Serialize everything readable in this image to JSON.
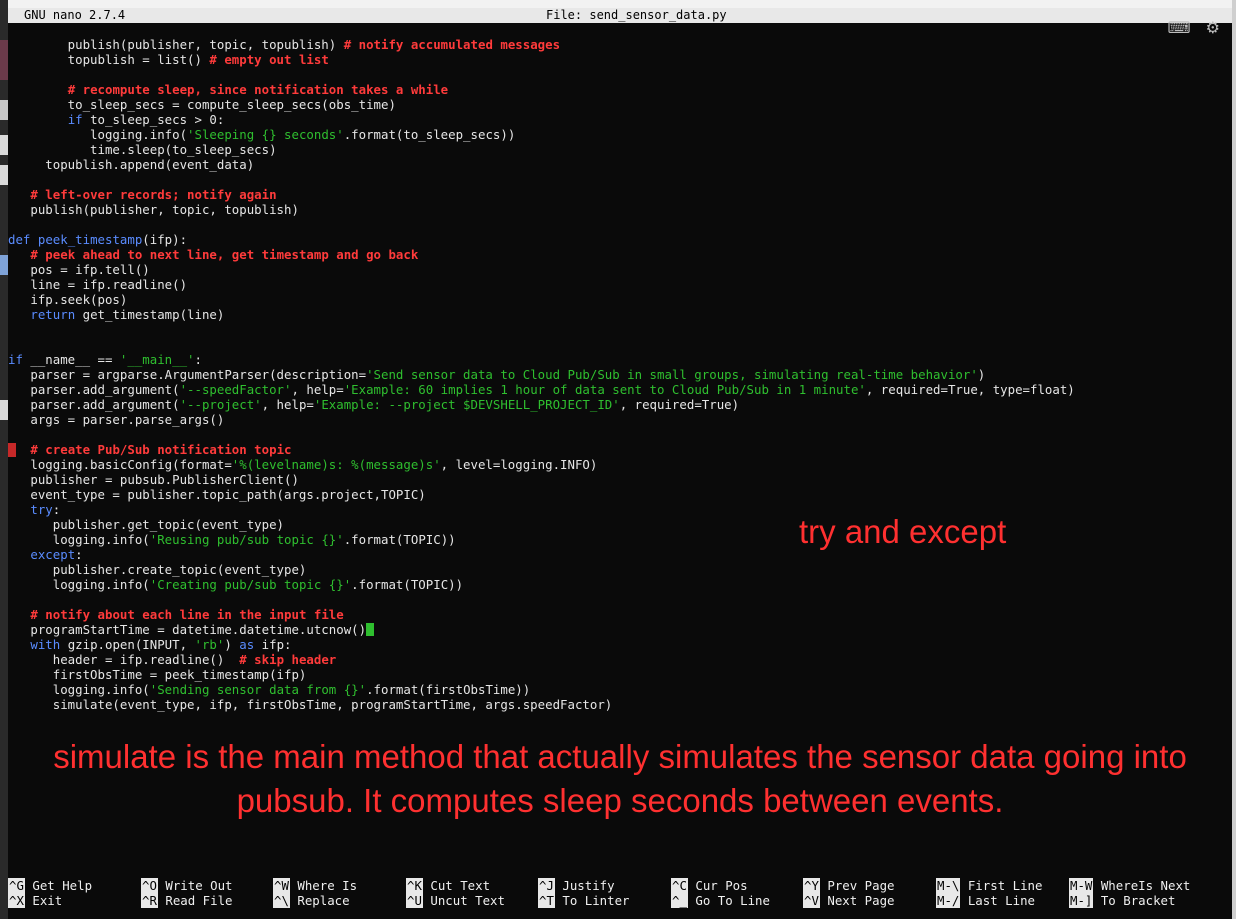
{
  "titlebar": {
    "version": "GNU nano 2.7.4",
    "file": "File: send_sensor_data.py"
  },
  "code_lines": [
    [
      [
        "p",
        "        publish(publisher, topic, topublish) "
      ],
      [
        "c",
        "# notify accumulated messages"
      ]
    ],
    [
      [
        "p",
        "        topublish = list() "
      ],
      [
        "c",
        "# empty out list"
      ]
    ],
    [
      [
        "p",
        ""
      ]
    ],
    [
      [
        "p",
        "        "
      ],
      [
        "c",
        "# recompute sleep, since notification takes a while"
      ]
    ],
    [
      [
        "p",
        "        to_sleep_secs = compute_sleep_secs(obs_time)"
      ]
    ],
    [
      [
        "p",
        "        "
      ],
      [
        "k",
        "if"
      ],
      [
        "p",
        " to_sleep_secs > 0:"
      ]
    ],
    [
      [
        "p",
        "           logging.info("
      ],
      [
        "s",
        "'Sleeping {} seconds'"
      ],
      [
        "p",
        ".format(to_sleep_secs))"
      ]
    ],
    [
      [
        "p",
        "           time.sleep(to_sleep_secs)"
      ]
    ],
    [
      [
        "p",
        "     topublish.append(event_data)"
      ]
    ],
    [
      [
        "p",
        ""
      ]
    ],
    [
      [
        "p",
        "   "
      ],
      [
        "c",
        "# left-over records; notify again"
      ]
    ],
    [
      [
        "p",
        "   publish(publisher, topic, topublish)"
      ]
    ],
    [
      [
        "p",
        ""
      ]
    ],
    [
      [
        "k",
        "def"
      ],
      [
        "p",
        " "
      ],
      [
        "k",
        "peek_timestamp"
      ],
      [
        "p",
        "(ifp):"
      ]
    ],
    [
      [
        "p",
        "   "
      ],
      [
        "c",
        "# peek ahead to next line, get timestamp and go back"
      ]
    ],
    [
      [
        "p",
        "   pos = ifp.tell()"
      ]
    ],
    [
      [
        "p",
        "   line = ifp.readline()"
      ]
    ],
    [
      [
        "p",
        "   ifp.seek(pos)"
      ]
    ],
    [
      [
        "p",
        "   "
      ],
      [
        "k",
        "return"
      ],
      [
        "p",
        " get_timestamp(line)"
      ]
    ],
    [
      [
        "p",
        ""
      ]
    ],
    [
      [
        "p",
        ""
      ]
    ],
    [
      [
        "k",
        "if"
      ],
      [
        "p",
        " __name__ == "
      ],
      [
        "s",
        "'__main__'"
      ],
      [
        "p",
        ":"
      ]
    ],
    [
      [
        "p",
        "   parser = argparse.ArgumentParser(description="
      ],
      [
        "s",
        "'Send sensor data to Cloud Pub/Sub in small groups, simulating real-time behavior'"
      ],
      [
        "p",
        ")"
      ]
    ],
    [
      [
        "p",
        "   parser.add_argument("
      ],
      [
        "s",
        "'--speedFactor'"
      ],
      [
        "p",
        ", help="
      ],
      [
        "s",
        "'Example: 60 implies 1 hour of data sent to Cloud Pub/Sub in 1 minute'"
      ],
      [
        "p",
        ", required=True, type=float)"
      ]
    ],
    [
      [
        "p",
        "   parser.add_argument("
      ],
      [
        "s",
        "'--project'"
      ],
      [
        "p",
        ", help="
      ],
      [
        "s",
        "'Example: --project $DEVSHELL_PROJECT_ID'"
      ],
      [
        "p",
        ", required=True)"
      ]
    ],
    [
      [
        "p",
        "   args = parser.parse_args()"
      ]
    ],
    [
      [
        "p",
        ""
      ]
    ],
    [
      [
        "p",
        "   "
      ],
      [
        "c",
        "# create Pub/Sub notification topic"
      ]
    ],
    [
      [
        "p",
        "   logging.basicConfig(format="
      ],
      [
        "s",
        "'%(levelname)s: %(message)s'"
      ],
      [
        "p",
        ", level=logging.INFO)"
      ]
    ],
    [
      [
        "p",
        "   publisher = pubsub.PublisherClient()"
      ]
    ],
    [
      [
        "p",
        "   event_type = publisher.topic_path(args.project,TOPIC)"
      ]
    ],
    [
      [
        "p",
        "   "
      ],
      [
        "k",
        "try"
      ],
      [
        "p",
        ":"
      ]
    ],
    [
      [
        "p",
        "      publisher.get_topic(event_type)"
      ]
    ],
    [
      [
        "p",
        "      logging.info("
      ],
      [
        "s",
        "'Reusing pub/sub topic {}'"
      ],
      [
        "p",
        ".format(TOPIC))"
      ]
    ],
    [
      [
        "p",
        "   "
      ],
      [
        "k",
        "except"
      ],
      [
        "p",
        ":"
      ]
    ],
    [
      [
        "p",
        "      publisher.create_topic(event_type)"
      ]
    ],
    [
      [
        "p",
        "      logging.info("
      ],
      [
        "s",
        "'Creating pub/sub topic {}'"
      ],
      [
        "p",
        ".format(TOPIC))"
      ]
    ],
    [
      [
        "p",
        ""
      ]
    ],
    [
      [
        "p",
        "   "
      ],
      [
        "c",
        "# notify about each line in the input file"
      ]
    ],
    [
      [
        "p",
        "   programStartTime = datetime.datetime.utcnow()"
      ],
      [
        "cursor",
        ""
      ]
    ],
    [
      [
        "p",
        "   "
      ],
      [
        "k",
        "with"
      ],
      [
        "p",
        " gzip.open(INPUT, "
      ],
      [
        "s",
        "'rb'"
      ],
      [
        "p",
        ") "
      ],
      [
        "k",
        "as"
      ],
      [
        "p",
        " ifp:"
      ]
    ],
    [
      [
        "p",
        "      header = ifp.readline()  "
      ],
      [
        "c",
        "# skip header"
      ]
    ],
    [
      [
        "p",
        "      firstObsTime = peek_timestamp(ifp)"
      ]
    ],
    [
      [
        "p",
        "      logging.info("
      ],
      [
        "s",
        "'Sending sensor data from {}'"
      ],
      [
        "p",
        ".format(firstObsTime))"
      ]
    ],
    [
      [
        "p",
        "      simulate(event_type, ifp, firstObsTime, programStartTime, args.speedFactor)"
      ]
    ]
  ],
  "annotations": {
    "try_note": "try and except",
    "simulate_note": "simulate is the main method that actually simulates the sensor data going into pubsub. It computes sleep seconds between events."
  },
  "shortcuts": [
    {
      "key": "^G",
      "label": "Get Help"
    },
    {
      "key": "^X",
      "label": "Exit"
    },
    {
      "key": "^O",
      "label": "Write Out"
    },
    {
      "key": "^R",
      "label": "Read File"
    },
    {
      "key": "^W",
      "label": "Where Is"
    },
    {
      "key": "^\\",
      "label": "Replace"
    },
    {
      "key": "^K",
      "label": "Cut Text"
    },
    {
      "key": "^U",
      "label": "Uncut Text"
    },
    {
      "key": "^J",
      "label": "Justify"
    },
    {
      "key": "^T",
      "label": "To Linter"
    },
    {
      "key": "^C",
      "label": "Cur Pos"
    },
    {
      "key": "^_",
      "label": "Go To Line"
    },
    {
      "key": "^Y",
      "label": "Prev Page"
    },
    {
      "key": "^V",
      "label": "Next Page"
    },
    {
      "key": "M-\\",
      "label": "First Line"
    },
    {
      "key": "M-/",
      "label": "Last Line"
    },
    {
      "key": "M-W",
      "label": "WhereIs Next"
    },
    {
      "key": "M-]",
      "label": "To Bracket"
    }
  ],
  "icons": [
    "keyboard-icon",
    "gear-icon"
  ]
}
